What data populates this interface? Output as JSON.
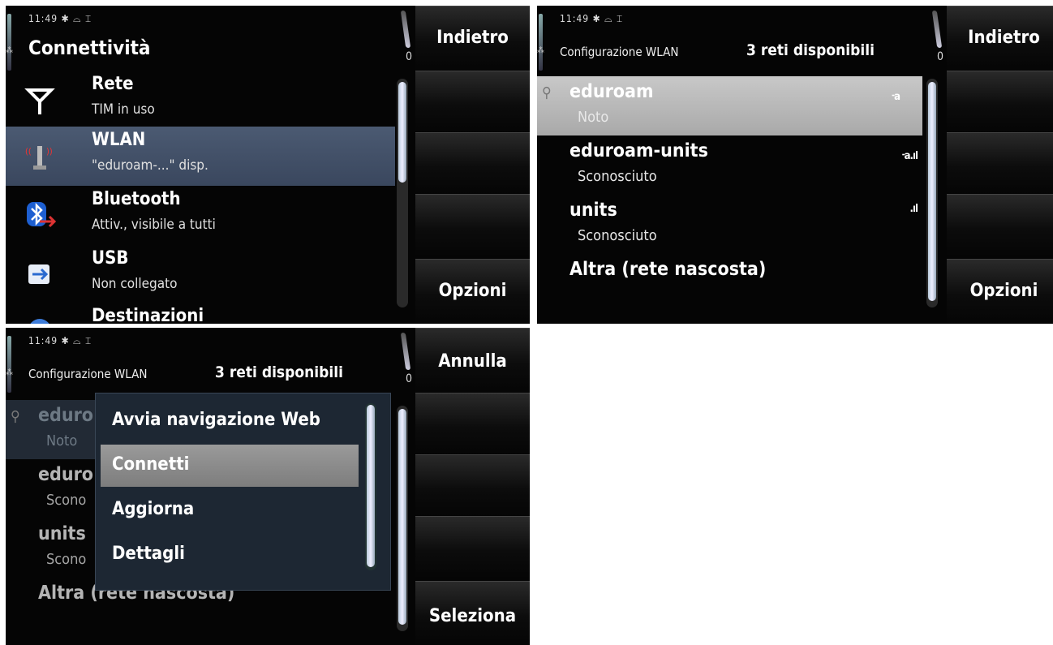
{
  "screen1": {
    "status_time": "11:49",
    "title": "Connettività",
    "indicator": "0",
    "softkeys": {
      "top": "Indietro",
      "bottom": "Opzioni"
    },
    "items": [
      {
        "icon": "antenna-icon",
        "label": "Rete",
        "sub": "TIM in uso"
      },
      {
        "icon": "wlan-icon",
        "label": "WLAN",
        "sub": "\"eduroam-...\" disp."
      },
      {
        "icon": "bluetooth-icon",
        "label": "Bluetooth",
        "sub": "Attiv., visibile a tutti"
      },
      {
        "icon": "usb-icon",
        "label": "USB",
        "sub": "Non collegato"
      },
      {
        "icon": "globe-icon",
        "label": "Destinazioni",
        "sub": ""
      }
    ]
  },
  "screen2": {
    "status_time": "11:49",
    "title": "Configurazione WLAN",
    "count": "3 reti disponibili",
    "indicator": "0",
    "softkeys": {
      "top": "Indietro",
      "bottom": "Opzioni"
    },
    "networks": [
      {
        "name": "eduroam",
        "status": "Noto",
        "signal": "᠊a"
      },
      {
        "name": "eduroam-units",
        "status": "Sconosciuto",
        "signal": "᠊a.ıl"
      },
      {
        "name": "units",
        "status": "Sconosciuto",
        "signal": ".ıl"
      },
      {
        "name": "Altra (rete nascosta)",
        "status": "",
        "signal": ""
      }
    ]
  },
  "screen3": {
    "status_time": "11:49",
    "title": "Configurazione WLAN",
    "count": "3 reti disponibili",
    "indicator": "0",
    "softkeys": {
      "top": "Annulla",
      "bottom": "Seleziona"
    },
    "bg_items": [
      {
        "name": "eduro",
        "status": "Noto"
      },
      {
        "name": "eduro",
        "status": "Scono"
      },
      {
        "name": "units",
        "status": "Scono"
      }
    ],
    "bg_other": "Altra (rete nascosta)",
    "menu": [
      "Avvia navigazione Web",
      "Connetti",
      "Aggiorna",
      "Dettagli"
    ]
  },
  "colors": {
    "selection": "#4b5a72",
    "highlight": "#b5b5b5",
    "menu_bg": "#1d2733"
  }
}
